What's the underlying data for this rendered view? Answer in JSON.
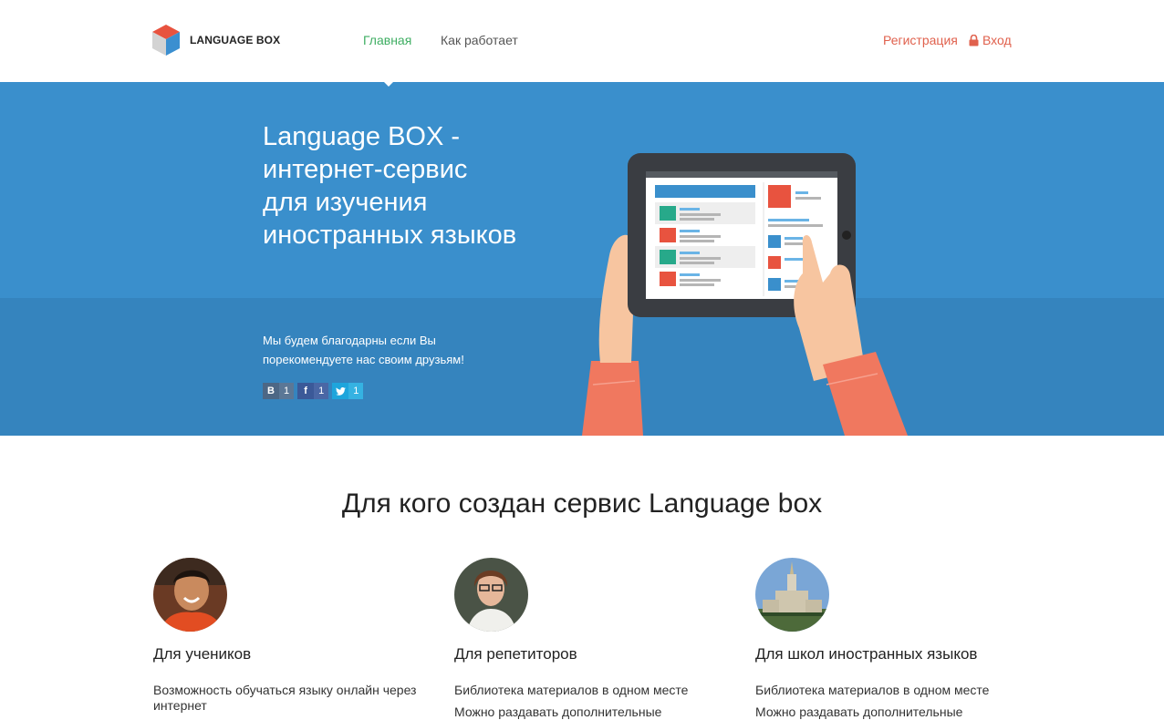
{
  "header": {
    "logo_text": "LANGUAGE BOX",
    "nav": {
      "main": "Главная",
      "how": "Как работает",
      "register": "Регистрация",
      "login": "Вход"
    }
  },
  "hero": {
    "title_lines": [
      "Language BOX -",
      "интернет-сервис",
      "для изучения",
      "иностранных языков"
    ],
    "recommend_text": "Мы будем благодарны если Вы порекомендуете нас своим друзьям!",
    "share": {
      "vk": {
        "icon": "B",
        "count": "1"
      },
      "fb": {
        "icon": "f",
        "count": "1"
      },
      "tw": {
        "icon": "t",
        "count": "1"
      }
    }
  },
  "audience": {
    "title": "Для кого создан сервис Language box",
    "columns": [
      {
        "title": "Для учеников",
        "items": [
          "Возможность обучаться языку онлайн через интернет"
        ]
      },
      {
        "title": "Для репетиторов",
        "items": [
          "Библиотека материалов в одном месте",
          "Можно раздавать дополнительные"
        ]
      },
      {
        "title": "Для школ иностранных языков",
        "items": [
          "Библиотека материалов в одном месте",
          "Можно раздавать дополнительные"
        ]
      }
    ]
  },
  "colors": {
    "hero_blue": "#3a8fcc",
    "hero_blue_dark": "#3584be",
    "accent_green": "#3fae63",
    "accent_red": "#e0614d"
  }
}
